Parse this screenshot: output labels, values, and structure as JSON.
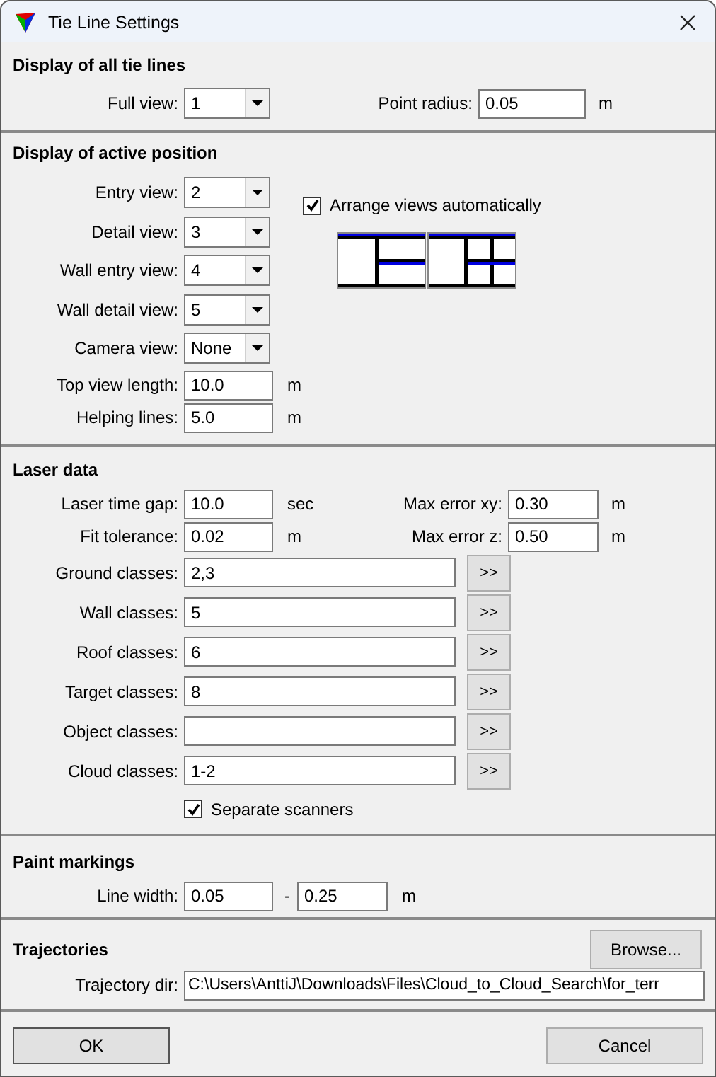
{
  "window": {
    "title": "Tie Line Settings"
  },
  "all_tie_lines": {
    "title": "Display of all tie lines",
    "full_view": {
      "label": "Full view:",
      "value": "1"
    },
    "point_radius": {
      "label": "Point radius:",
      "value": "0.05",
      "unit": "m"
    }
  },
  "active_position": {
    "title": "Display of active position",
    "dropdowns": [
      {
        "label": "Entry view:",
        "value": "2"
      },
      {
        "label": "Detail view:",
        "value": "3"
      },
      {
        "label": "Wall entry view:",
        "value": "4"
      },
      {
        "label": "Wall detail view:",
        "value": "5"
      },
      {
        "label": "Camera view:",
        "value": "None"
      }
    ],
    "fields": [
      {
        "label": "Top view length:",
        "value": "10.0",
        "unit": "m"
      },
      {
        "label": "Helping lines:",
        "value": "5.0",
        "unit": "m"
      }
    ],
    "arrange": {
      "label": "Arrange views automatically",
      "checked": true
    }
  },
  "laser_data": {
    "title": "Laser data",
    "pairs": [
      {
        "left": {
          "label": "Laser time gap:",
          "value": "10.0",
          "unit": "sec"
        },
        "right": {
          "label": "Max error xy:",
          "value": "0.30",
          "unit": "m"
        }
      },
      {
        "left": {
          "label": "Fit tolerance:",
          "value": "0.02",
          "unit": "m"
        },
        "right": {
          "label": "Max error z:",
          "value": "0.50",
          "unit": "m"
        }
      }
    ],
    "classes": [
      {
        "label": "Ground classes:",
        "value": "2,3",
        "button": ">>"
      },
      {
        "label": "Wall classes:",
        "value": "5",
        "button": ">>"
      },
      {
        "label": "Roof classes:",
        "value": "6",
        "button": ">>"
      },
      {
        "label": "Target classes:",
        "value": "8",
        "button": ">>"
      },
      {
        "label": "Object classes:",
        "button": ">>"
      },
      {
        "label": "Cloud classes:",
        "value": "1-2",
        "button": ">>"
      }
    ],
    "separate": {
      "label": "Separate scanners",
      "checked": true
    }
  },
  "paint_markings": {
    "title": "Paint markings",
    "label": "Line width:",
    "from": "0.05",
    "separator": "-",
    "to": "0.25",
    "unit": "m"
  },
  "trajectories": {
    "title": "Trajectories",
    "browse": "Browse...",
    "label": "Trajectory dir:",
    "value": "C:\\Users\\AnttiJ\\Downloads\\Files\\Cloud_to_Cloud_Search\\for_terr"
  },
  "buttons": [
    "OK",
    "Cancel"
  ]
}
